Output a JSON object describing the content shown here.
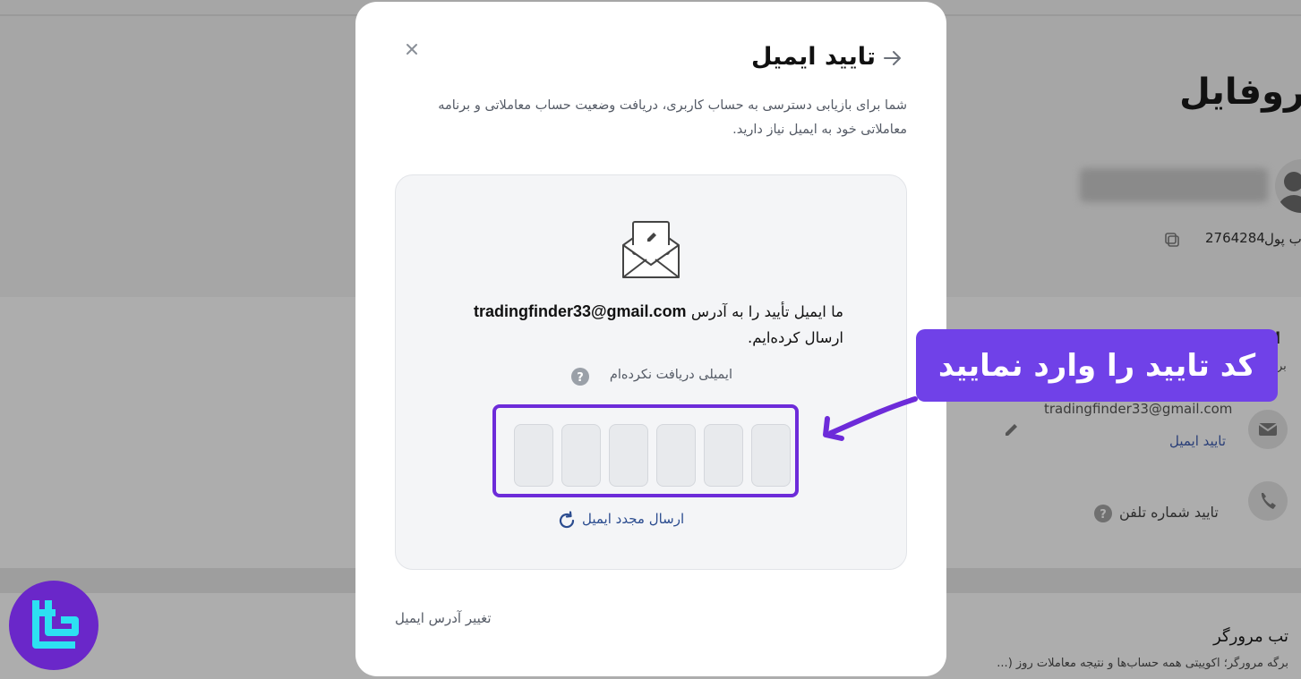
{
  "background": {
    "page_title": "روفایل",
    "wallet_label": "ب پول",
    "wallet_id": "2764284",
    "email": "tradingfinder33@gmail.com",
    "verify_email_link": "تایید ایمیل",
    "verify_phone": "تایید شماره تلفن",
    "right_heading": "ا",
    "right_sub": "بر",
    "tab_title": "تب مرورگر",
    "tab_desc": "برگه مرورگر؛ اکوییتی همه حساب‌ها و نتیجه معاملات روز (..."
  },
  "modal": {
    "title": "تایید ایمیل",
    "description": "شما برای بازیابی دسترسی به حساب کاربری، دریافت وضعیت حساب معاملاتی و برنامه معاملاتی خود به ایمیل نیاز دارید.",
    "sent_prefix": "ما ایمیل تأیید را به آدرس",
    "sent_email": "tradingfinder33@gmail.com",
    "sent_suffix": "ارسال کرده‌ایم.",
    "no_email": "ایمیلی دریافت نکرده‌ام",
    "code_length": 6,
    "resend": "ارسال مجدد ایمیل",
    "change_email": "تغییر آدرس ایمیل"
  },
  "callout": {
    "text": "کد تایید را وارد نمایید",
    "color": "#7041e8"
  },
  "colors": {
    "highlight_border": "#6d2bd9",
    "link": "#2b4c8f",
    "logo_bg": "#6a27c9"
  }
}
